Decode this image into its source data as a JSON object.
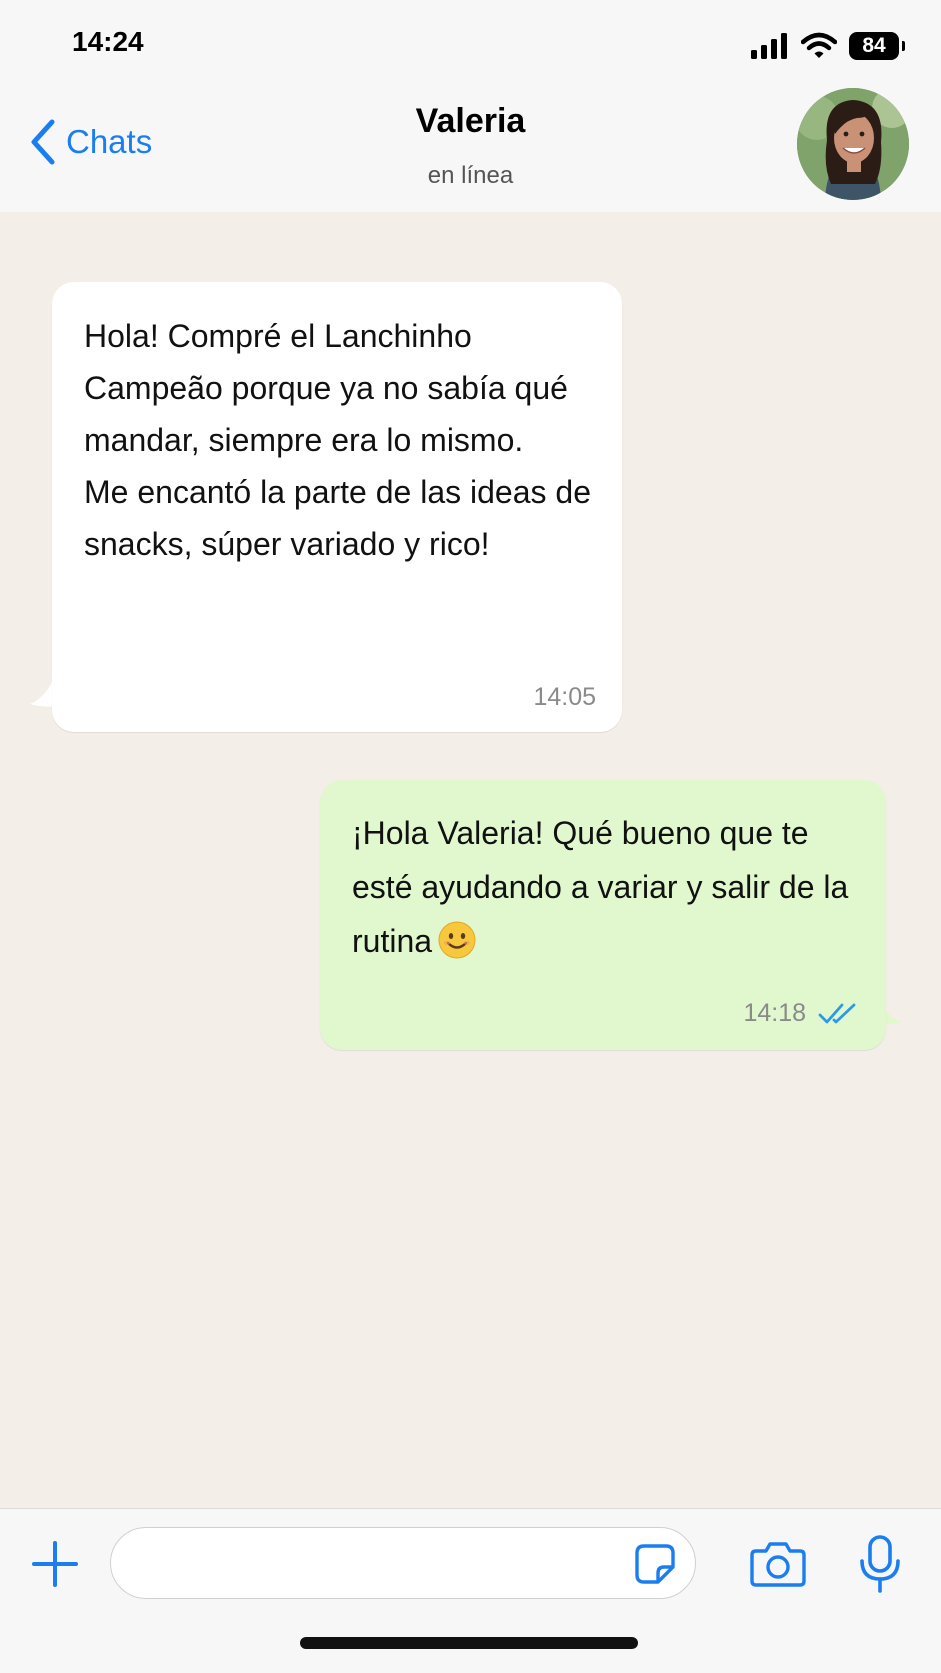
{
  "status_bar": {
    "time": "14:24",
    "battery": "84"
  },
  "header": {
    "back_label": "Chats",
    "contact_name": "Valeria",
    "contact_status": "en línea"
  },
  "messages": [
    {
      "direction": "incoming",
      "text": "Hola! Compré el Lanchinho Campeão porque ya no sabía qué mandar, siempre era lo mismo.\nMe encantó la parte de las ideas de snacks, súper variado y rico!",
      "time": "14:05"
    },
    {
      "direction": "outgoing",
      "text": "¡Hola Valeria! Qué bueno que te esté ayudando a variar y salir de la rutina",
      "emoji": "smiling-face",
      "time": "14:18",
      "read_status": "double-check-read"
    }
  ],
  "composer": {
    "placeholder": ""
  },
  "colors": {
    "accent": "#1a7ef0",
    "outgoing_bubble": "#e1f8cf",
    "incoming_bubble": "#ffffff",
    "chat_background": "#f3eee7"
  },
  "icons": [
    "chevron-left-icon",
    "signal-icon",
    "wifi-icon",
    "battery-icon",
    "plus-icon",
    "sticker-icon",
    "camera-icon",
    "microphone-icon",
    "double-check-icon"
  ]
}
